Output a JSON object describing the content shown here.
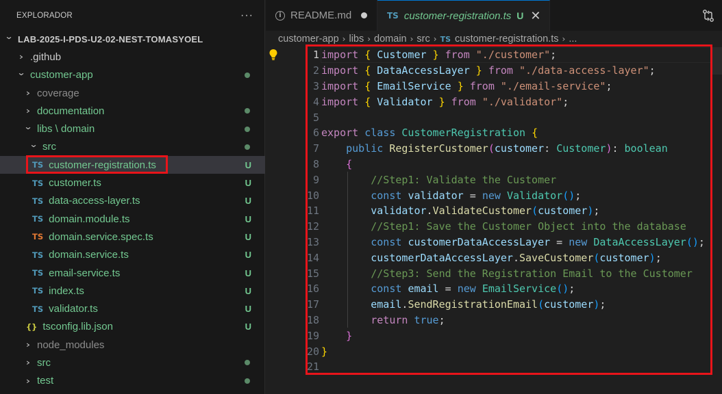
{
  "sidebar": {
    "title": "EXPLORADOR",
    "more_label": "···",
    "tree": [
      {
        "label": "LAB-2025-I-PDS-U2-02-NEST-TOMASYOEL",
        "indent": 0,
        "chev": "down",
        "root": true,
        "color": "plain"
      },
      {
        "label": ".github",
        "indent": 1,
        "chev": "right",
        "color": "plain"
      },
      {
        "label": "customer-app",
        "indent": 1,
        "chev": "down",
        "color": "green",
        "dot": true
      },
      {
        "label": "coverage",
        "indent": 2,
        "chev": "right",
        "color": "gray"
      },
      {
        "label": "documentation",
        "indent": 2,
        "chev": "right",
        "color": "green",
        "dot": true
      },
      {
        "label": "libs \\ domain",
        "indent": 2,
        "chev": "down",
        "color": "green",
        "dot": true
      },
      {
        "label": "src",
        "indent": 3,
        "chev": "down",
        "color": "green",
        "dot": true
      },
      {
        "label": "customer-registration.ts",
        "indent": 4,
        "icon": "TS",
        "icon_color": "#519aba",
        "color": "green",
        "badge": "U",
        "selected": true
      },
      {
        "label": "customer.ts",
        "indent": 4,
        "icon": "TS",
        "icon_color": "#519aba",
        "color": "green",
        "badge": "U"
      },
      {
        "label": "data-access-layer.ts",
        "indent": 4,
        "icon": "TS",
        "icon_color": "#519aba",
        "color": "green",
        "badge": "U"
      },
      {
        "label": "domain.module.ts",
        "indent": 4,
        "icon": "TS",
        "icon_color": "#519aba",
        "color": "green",
        "badge": "U"
      },
      {
        "label": "domain.service.spec.ts",
        "indent": 4,
        "icon": "TS",
        "icon_color": "#e37933",
        "color": "green",
        "badge": "U"
      },
      {
        "label": "domain.service.ts",
        "indent": 4,
        "icon": "TS",
        "icon_color": "#519aba",
        "color": "green",
        "badge": "U"
      },
      {
        "label": "email-service.ts",
        "indent": 4,
        "icon": "TS",
        "icon_color": "#519aba",
        "color": "green",
        "badge": "U"
      },
      {
        "label": "index.ts",
        "indent": 4,
        "icon": "TS",
        "icon_color": "#519aba",
        "color": "green",
        "badge": "U"
      },
      {
        "label": "validator.ts",
        "indent": 4,
        "icon": "TS",
        "icon_color": "#519aba",
        "color": "green",
        "badge": "U"
      },
      {
        "label": "tsconfig.lib.json",
        "indent": 3,
        "icon": "{}",
        "icon_color": "#cbcb41",
        "color": "green",
        "badge": "U"
      },
      {
        "label": "node_modules",
        "indent": 2,
        "chev": "right",
        "color": "gray"
      },
      {
        "label": "src",
        "indent": 2,
        "chev": "right",
        "color": "green",
        "dot": true
      },
      {
        "label": "test",
        "indent": 2,
        "chev": "right",
        "color": "green",
        "dot": true
      }
    ]
  },
  "tabs": [
    {
      "title": "README.md",
      "icon": "info-icon",
      "dirty": true,
      "active": false
    },
    {
      "title": "customer-registration.ts",
      "icon": "TS",
      "badge": "U",
      "close": "✕",
      "active": true
    }
  ],
  "breadcrumb": [
    "customer-app",
    "libs",
    "domain",
    "src",
    "customer-registration.ts",
    "..."
  ],
  "editor": {
    "current_line": 1,
    "lines": [
      {
        "n": "1",
        "tokens": [
          [
            "import",
            "kw-imp"
          ],
          [
            " ",
            "plain"
          ],
          [
            "{",
            "br1"
          ],
          [
            " Customer ",
            "var"
          ],
          [
            "}",
            "br1"
          ],
          [
            " from ",
            "kw-imp"
          ],
          [
            "\"./customer\"",
            "str"
          ],
          [
            ";",
            "plain"
          ]
        ]
      },
      {
        "n": "2",
        "tokens": [
          [
            "import",
            "kw-imp"
          ],
          [
            " ",
            "plain"
          ],
          [
            "{",
            "br1"
          ],
          [
            " DataAccessLayer ",
            "var"
          ],
          [
            "}",
            "br1"
          ],
          [
            " from ",
            "kw-imp"
          ],
          [
            "\"./data-access-layer\"",
            "str"
          ],
          [
            ";",
            "plain"
          ]
        ]
      },
      {
        "n": "3",
        "tokens": [
          [
            "import",
            "kw-imp"
          ],
          [
            " ",
            "plain"
          ],
          [
            "{",
            "br1"
          ],
          [
            " EmailService ",
            "var"
          ],
          [
            "}",
            "br1"
          ],
          [
            " from ",
            "kw-imp"
          ],
          [
            "\"./email-service\"",
            "str"
          ],
          [
            ";",
            "plain"
          ]
        ]
      },
      {
        "n": "4",
        "tokens": [
          [
            "import",
            "kw-imp"
          ],
          [
            " ",
            "plain"
          ],
          [
            "{",
            "br1"
          ],
          [
            " Validator ",
            "var"
          ],
          [
            "}",
            "br1"
          ],
          [
            " from ",
            "kw-imp"
          ],
          [
            "\"./validator\"",
            "str"
          ],
          [
            ";",
            "plain"
          ]
        ]
      },
      {
        "n": "5",
        "tokens": []
      },
      {
        "n": "6",
        "tokens": [
          [
            "export",
            "kw-imp"
          ],
          [
            " ",
            "plain"
          ],
          [
            "class",
            "kw"
          ],
          [
            " ",
            "plain"
          ],
          [
            "CustomerRegistration",
            "cls"
          ],
          [
            " ",
            "plain"
          ],
          [
            "{",
            "br1"
          ]
        ]
      },
      {
        "n": "7",
        "tokens": [
          [
            "    ",
            "plain"
          ],
          [
            "public",
            "kw"
          ],
          [
            " ",
            "plain"
          ],
          [
            "RegisterCustomer",
            "fn"
          ],
          [
            "(",
            "br2"
          ],
          [
            "customer",
            "var"
          ],
          [
            ": ",
            "plain"
          ],
          [
            "Customer",
            "cls"
          ],
          [
            ")",
            "br2"
          ],
          [
            ": ",
            "plain"
          ],
          [
            "boolean",
            "cls"
          ]
        ]
      },
      {
        "n": "8",
        "tokens": [
          [
            "    ",
            "plain"
          ],
          [
            "{",
            "br2"
          ]
        ]
      },
      {
        "n": "9",
        "tokens": [
          [
            "        ",
            "plain"
          ],
          [
            "//Step1: Validate the Customer",
            "cmt"
          ]
        ]
      },
      {
        "n": "10",
        "tokens": [
          [
            "        ",
            "plain"
          ],
          [
            "const",
            "kw"
          ],
          [
            " ",
            "plain"
          ],
          [
            "validator",
            "var"
          ],
          [
            " = ",
            "plain"
          ],
          [
            "new",
            "kw"
          ],
          [
            " ",
            "plain"
          ],
          [
            "Validator",
            "cls"
          ],
          [
            "()",
            "br3"
          ],
          [
            ";",
            "plain"
          ]
        ]
      },
      {
        "n": "11",
        "tokens": [
          [
            "        ",
            "plain"
          ],
          [
            "validator",
            "var"
          ],
          [
            ".",
            "plain"
          ],
          [
            "ValidateCustomer",
            "fn"
          ],
          [
            "(",
            "br3"
          ],
          [
            "customer",
            "var"
          ],
          [
            ")",
            "br3"
          ],
          [
            ";",
            "plain"
          ]
        ]
      },
      {
        "n": "12",
        "tokens": [
          [
            "        ",
            "plain"
          ],
          [
            "//Step1: Save the Customer Object into the database",
            "cmt"
          ]
        ]
      },
      {
        "n": "13",
        "tokens": [
          [
            "        ",
            "plain"
          ],
          [
            "const",
            "kw"
          ],
          [
            " ",
            "plain"
          ],
          [
            "customerDataAccessLayer",
            "var"
          ],
          [
            " = ",
            "plain"
          ],
          [
            "new",
            "kw"
          ],
          [
            " ",
            "plain"
          ],
          [
            "DataAccessLayer",
            "cls"
          ],
          [
            "()",
            "br3"
          ],
          [
            ";",
            "plain"
          ]
        ]
      },
      {
        "n": "14",
        "tokens": [
          [
            "        ",
            "plain"
          ],
          [
            "customerDataAccessLayer",
            "var"
          ],
          [
            ".",
            "plain"
          ],
          [
            "SaveCustomer",
            "fn"
          ],
          [
            "(",
            "br3"
          ],
          [
            "customer",
            "var"
          ],
          [
            ")",
            "br3"
          ],
          [
            ";",
            "plain"
          ]
        ]
      },
      {
        "n": "15",
        "tokens": [
          [
            "        ",
            "plain"
          ],
          [
            "//Step3: Send the Registration Email to the Customer",
            "cmt"
          ]
        ]
      },
      {
        "n": "16",
        "tokens": [
          [
            "        ",
            "plain"
          ],
          [
            "const",
            "kw"
          ],
          [
            " ",
            "plain"
          ],
          [
            "email",
            "var"
          ],
          [
            " = ",
            "plain"
          ],
          [
            "new",
            "kw"
          ],
          [
            " ",
            "plain"
          ],
          [
            "EmailService",
            "cls"
          ],
          [
            "()",
            "br3"
          ],
          [
            ";",
            "plain"
          ]
        ]
      },
      {
        "n": "17",
        "tokens": [
          [
            "        ",
            "plain"
          ],
          [
            "email",
            "var"
          ],
          [
            ".",
            "plain"
          ],
          [
            "SendRegistrationEmail",
            "fn"
          ],
          [
            "(",
            "br3"
          ],
          [
            "customer",
            "var"
          ],
          [
            ")",
            "br3"
          ],
          [
            ";",
            "plain"
          ]
        ]
      },
      {
        "n": "18",
        "tokens": [
          [
            "        ",
            "plain"
          ],
          [
            "return",
            "kw-imp"
          ],
          [
            " ",
            "plain"
          ],
          [
            "true",
            "kw"
          ],
          [
            ";",
            "plain"
          ]
        ]
      },
      {
        "n": "19",
        "tokens": [
          [
            "    ",
            "plain"
          ],
          [
            "}",
            "br2"
          ]
        ]
      },
      {
        "n": "20",
        "tokens": [
          [
            "}",
            "br1"
          ]
        ]
      },
      {
        "n": "21",
        "tokens": []
      }
    ]
  },
  "colors": {
    "highlight": "#e8141a",
    "untracked": "#73c991",
    "ts_icon": "#519aba",
    "spec_icon": "#e37933",
    "json_icon": "#cbcb41"
  },
  "icons": {
    "lightbulb": "lightbulb-icon",
    "compare": "compare-changes-icon",
    "more": "more-actions-icon"
  }
}
